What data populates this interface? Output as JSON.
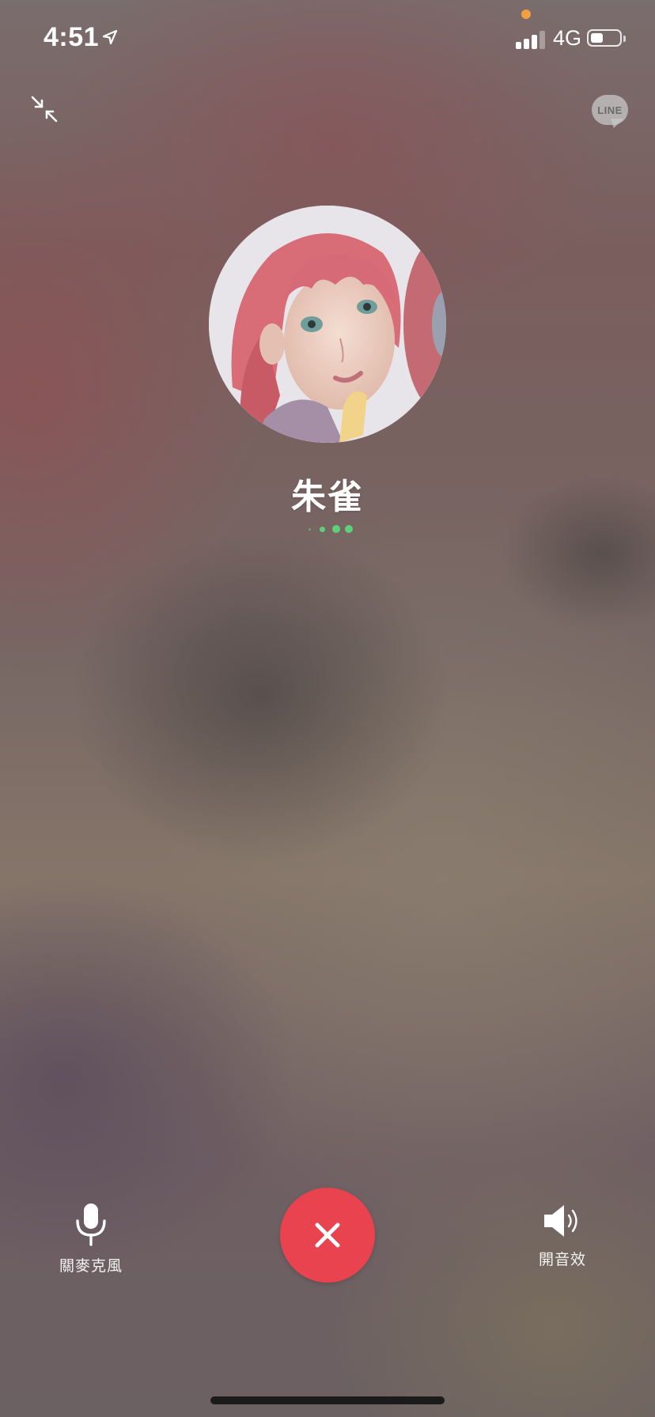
{
  "status_bar": {
    "time": "4:51",
    "network": "4G",
    "battery_level": 0.45,
    "signal_bars": 3,
    "icons": [
      "location-arrow-icon",
      "signal-icon",
      "battery-icon"
    ],
    "privacy_dot_color": "#f0a040"
  },
  "header": {
    "minimize_icon": "minimize-arrows-icon",
    "badge_text": "LINE"
  },
  "contact": {
    "name": "朱雀",
    "status_indicator": "calling-dots"
  },
  "controls": {
    "mic_label": "關麥克風",
    "mic_icon": "microphone-icon",
    "end_icon": "close-icon",
    "speaker_label": "開音效",
    "speaker_icon": "speaker-icon"
  },
  "colors": {
    "end_call": "#e8434f",
    "dots": "#5fd07a"
  }
}
